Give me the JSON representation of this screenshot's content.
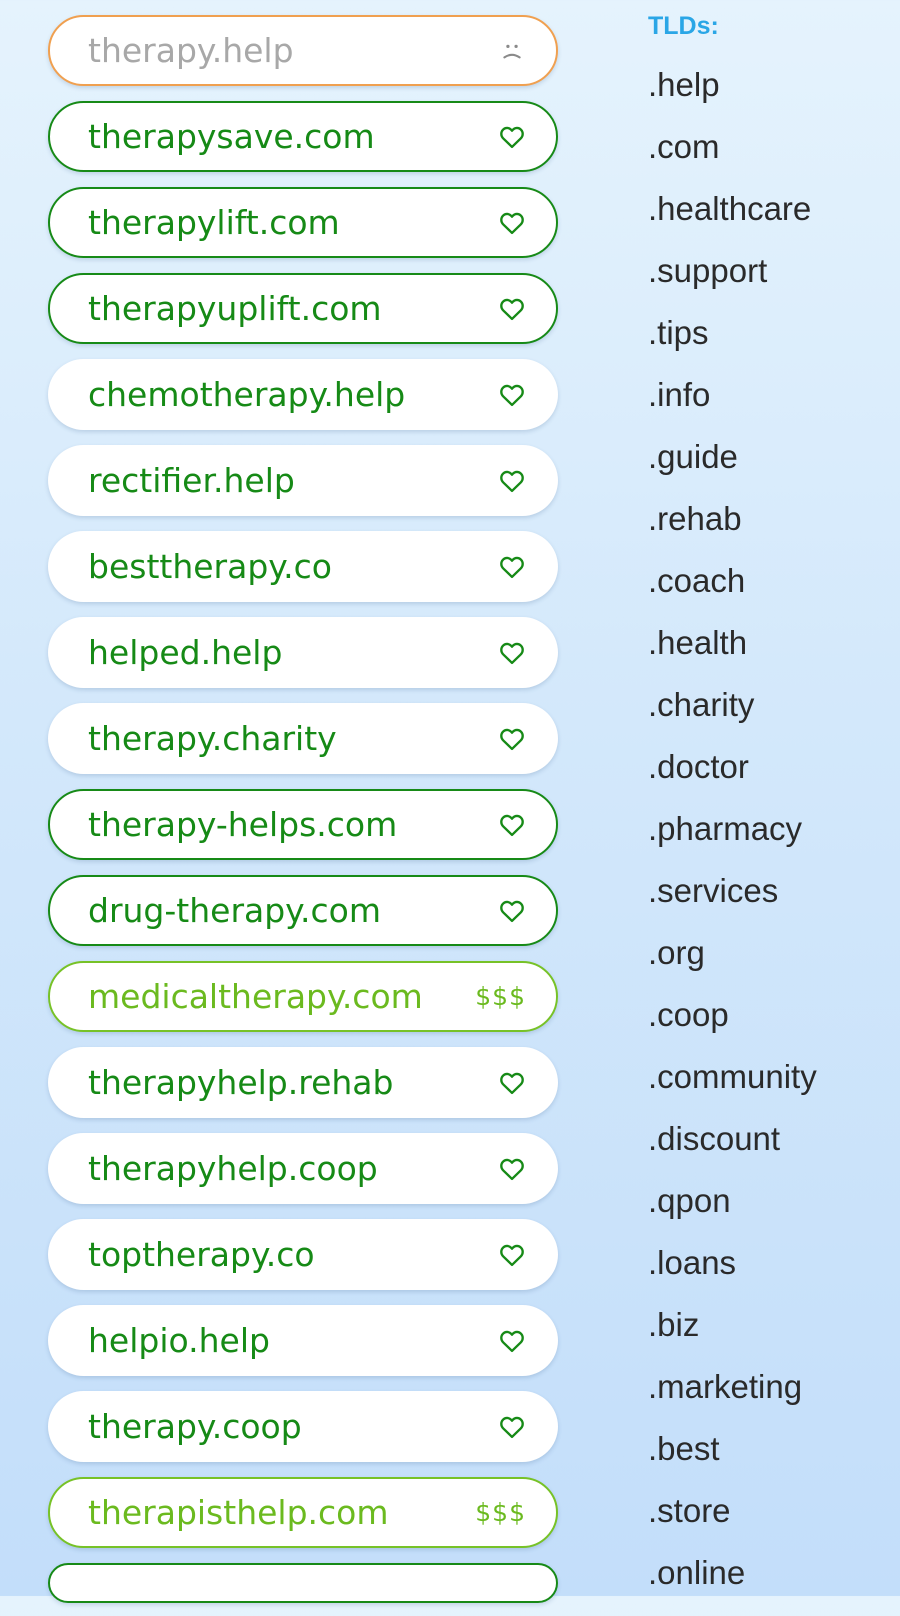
{
  "results": [
    {
      "name": "therapy.help",
      "state": "taken",
      "icon": "sad-face-icon"
    },
    {
      "name": "therapysave.com",
      "state": "outline",
      "icon": "heart-icon"
    },
    {
      "name": "therapylift.com",
      "state": "outline",
      "icon": "heart-icon"
    },
    {
      "name": "therapyuplift.com",
      "state": "outline",
      "icon": "heart-icon"
    },
    {
      "name": "chemotherapy.help",
      "state": "plain",
      "icon": "heart-icon"
    },
    {
      "name": "rectifier.help",
      "state": "plain",
      "icon": "heart-icon"
    },
    {
      "name": "besttherapy.co",
      "state": "plain",
      "icon": "heart-icon"
    },
    {
      "name": "helped.help",
      "state": "plain",
      "icon": "heart-icon"
    },
    {
      "name": "therapy.charity",
      "state": "plain",
      "icon": "heart-icon"
    },
    {
      "name": "therapy-helps.com",
      "state": "outline",
      "icon": "heart-icon"
    },
    {
      "name": "drug-therapy.com",
      "state": "outline",
      "icon": "heart-icon"
    },
    {
      "name": "medicaltherapy.com",
      "state": "premium",
      "icon": "price",
      "price": "$$$"
    },
    {
      "name": "therapyhelp.rehab",
      "state": "plain",
      "icon": "heart-icon"
    },
    {
      "name": "therapyhelp.coop",
      "state": "plain",
      "icon": "heart-icon"
    },
    {
      "name": "toptherapy.co",
      "state": "plain",
      "icon": "heart-icon"
    },
    {
      "name": "helpio.help",
      "state": "plain",
      "icon": "heart-icon"
    },
    {
      "name": "therapy.coop",
      "state": "plain",
      "icon": "heart-icon"
    },
    {
      "name": "therapisthelp.com",
      "state": "premium",
      "icon": "price",
      "price": "$$$"
    },
    {
      "name": "",
      "state": "outline",
      "icon": "none",
      "partial": true
    }
  ],
  "tld_panel": {
    "header": "TLDs:",
    "items": [
      ".help",
      ".com",
      ".healthcare",
      ".support",
      ".tips",
      ".info",
      ".guide",
      ".rehab",
      ".coach",
      ".health",
      ".charity",
      ".doctor",
      ".pharmacy",
      ".services",
      ".org",
      ".coop",
      ".community",
      ".discount",
      ".qpon",
      ".loans",
      ".biz",
      ".marketing",
      ".best",
      ".store",
      ".online"
    ]
  },
  "colors": {
    "available": "#168a16",
    "premium": "#6bba1f",
    "taken_border": "#f0a050",
    "taken_text": "#a8a8a8",
    "tld_header": "#2aa6e6",
    "tld_text": "#2a2a2a"
  }
}
